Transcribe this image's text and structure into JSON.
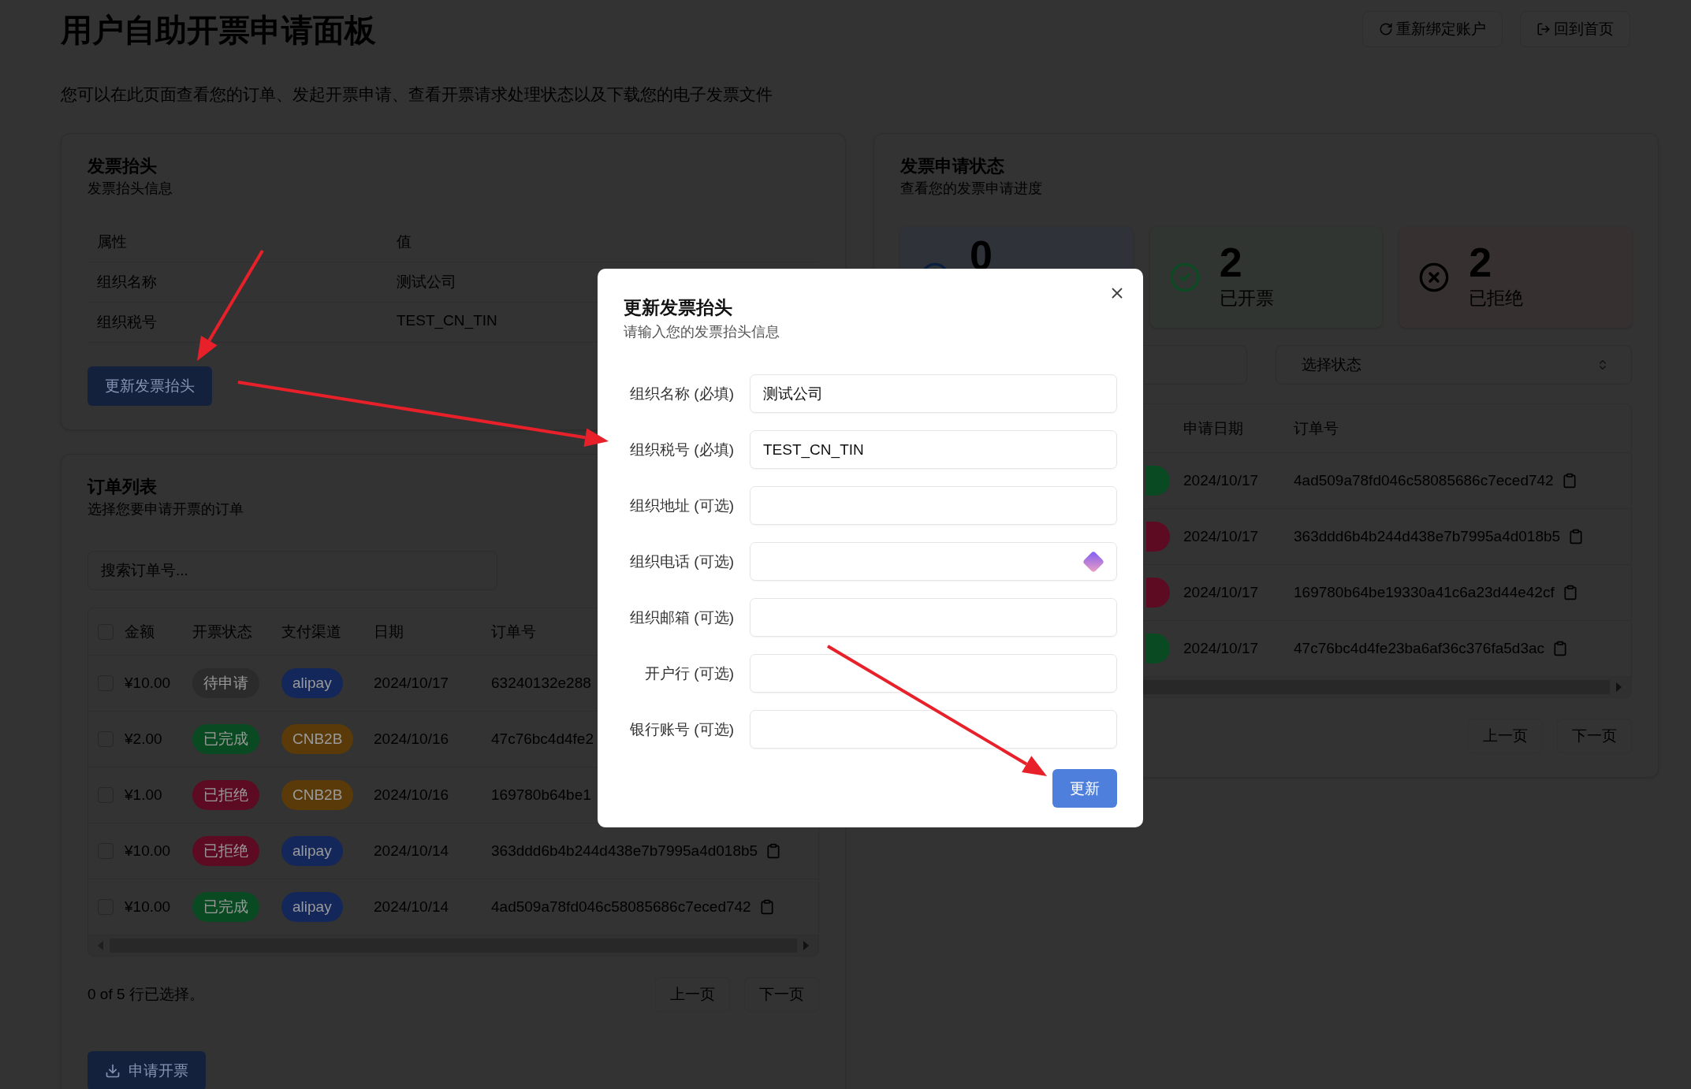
{
  "page": {
    "title": "用户自助开票申请面板",
    "subtitle": "您可以在此页面查看您的订单、发起开票申请、查看开票请求处理状态以及下载您的电子发票文件",
    "actions": [
      {
        "kind": "rebind",
        "label": "重新绑定账户"
      },
      {
        "kind": "home",
        "label": "回到首页"
      }
    ]
  },
  "header_card": {
    "title": "发票抬头",
    "subtitle": "发票抬头信息",
    "columns": [
      "属性",
      "值"
    ],
    "rows": [
      {
        "attribute": "组织名称",
        "value": "测试公司"
      },
      {
        "attribute": "组织税号",
        "value": "TEST_CN_TIN"
      }
    ],
    "button": "更新发票抬头"
  },
  "orders_card": {
    "title": "订单列表",
    "subtitle": "选择您要申请开票的订单",
    "search": {
      "placeholder": "搜索订单号..."
    },
    "all_checked": false,
    "columns": [
      "金额",
      "开票状态",
      "支付渠道",
      "日期",
      "订单号"
    ],
    "rows": [
      {
        "checked": false,
        "amount": "¥10.00",
        "status": {
          "label": "待申请",
          "color": "#2b2b2b"
        },
        "channel": {
          "label": "alipay",
          "color": "#14275a"
        },
        "date": "2024/10/17",
        "order_id": "63240132e288",
        "copy": false
      },
      {
        "checked": false,
        "amount": "¥2.00",
        "status": {
          "label": "已完成",
          "color": "#0a4a22"
        },
        "channel": {
          "label": "CNB2B",
          "color": "#5a3a08"
        },
        "date": "2024/10/16",
        "order_id": "47c76bc4d4fe2",
        "copy": false
      },
      {
        "checked": false,
        "amount": "¥1.00",
        "status": {
          "label": "已拒绝",
          "color": "#5c0b22"
        },
        "channel": {
          "label": "CNB2B",
          "color": "#5a3a08"
        },
        "date": "2024/10/16",
        "order_id": "169780b64be1",
        "copy": false
      },
      {
        "checked": false,
        "amount": "¥10.00",
        "status": {
          "label": "已拒绝",
          "color": "#5c0b22"
        },
        "channel": {
          "label": "alipay",
          "color": "#14275a"
        },
        "date": "2024/10/14",
        "order_id": "363ddd6b4b244d438e7b7995a4d018b5",
        "copy": true
      },
      {
        "checked": false,
        "amount": "¥10.00",
        "status": {
          "label": "已完成",
          "color": "#0a4a22"
        },
        "channel": {
          "label": "alipay",
          "color": "#14275a"
        },
        "date": "2024/10/14",
        "order_id": "4ad509a78fd046c58085686c7eced742",
        "copy": true
      }
    ],
    "selection_text": "0 of 5 行已选择。",
    "pager": [
      "上一页",
      "下一页"
    ],
    "submit": "申请开票"
  },
  "status_card": {
    "title": "发票申请状态",
    "subtitle": "查看您的发票申请进度",
    "stats": [
      {
        "kind": "pending",
        "value": "0"
      },
      {
        "kind": "issued",
        "value": "2",
        "label": "已开票"
      },
      {
        "kind": "rejected",
        "value": "2",
        "label": "已拒绝"
      }
    ],
    "filter": {
      "placeholder": "选择状态"
    },
    "columns": [
      "申请日期",
      "订单号"
    ],
    "rows": [
      {
        "color": "#0a4a22",
        "date": "2024/10/17",
        "order_id": "4ad509a78fd046c58085686c7eced742"
      },
      {
        "color": "#5c0b22",
        "date": "2024/10/17",
        "order_id": "363ddd6b4b244d438e7b7995a4d018b5"
      },
      {
        "color": "#5c0b22",
        "date": "2024/10/17",
        "order_id": "169780b64be19330a41c6a23d44e42cf"
      },
      {
        "color": "#0a4a22",
        "date": "2024/10/17",
        "order_id": "47c76bc4d4fe23ba6af36c376fa5d3ac"
      }
    ],
    "pager": [
      "上一页",
      "下一页"
    ]
  },
  "dialog": {
    "title": "更新发票抬头",
    "subtitle": "请输入您的发票抬头信息",
    "fields": [
      {
        "label": "组织名称 (必填)",
        "value": "测试公司"
      },
      {
        "label": "组织税号 (必填)",
        "value": "TEST_CN_TIN"
      },
      {
        "label": "组织地址 (可选)"
      },
      {
        "label": "组织电话 (可选)",
        "autofill": true
      },
      {
        "label": "组织邮箱 (可选)"
      },
      {
        "label": "开户行 (可选)"
      },
      {
        "label": "银行账号 (可选)"
      }
    ],
    "submit": "更新"
  }
}
